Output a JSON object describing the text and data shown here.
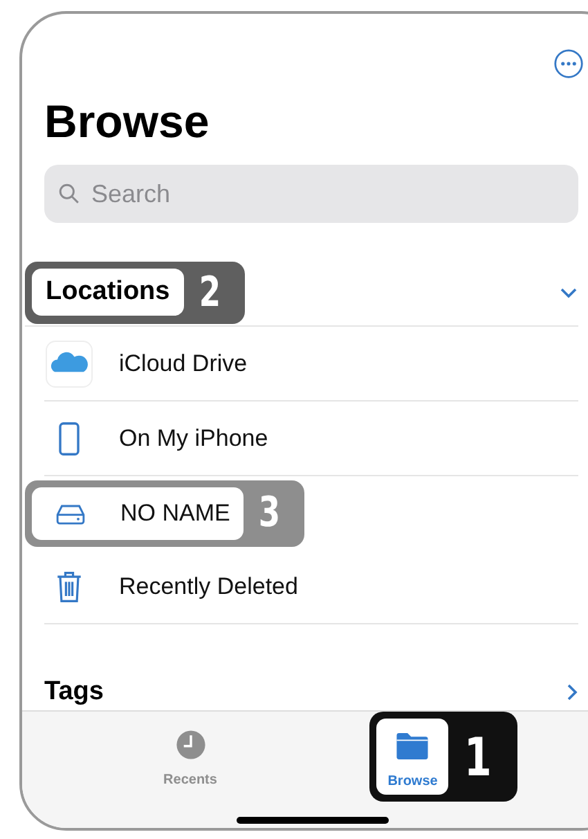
{
  "title": "Browse",
  "search": {
    "placeholder": "Search"
  },
  "locations": {
    "heading": "Locations",
    "expanded": true,
    "callout": {
      "number": "2",
      "color": "#5f5f5f"
    },
    "items": [
      {
        "kind": "cloud",
        "label": "iCloud Drive"
      },
      {
        "kind": "phone",
        "label": "On My iPhone"
      },
      {
        "kind": "drive",
        "label": "NO NAME",
        "callout": {
          "number": "3",
          "color": "#8e8e8e"
        }
      },
      {
        "kind": "trash",
        "label": "Recently Deleted"
      }
    ]
  },
  "tags": {
    "heading": "Tags"
  },
  "tabs": [
    {
      "kind": "clock",
      "label": "Recents",
      "selected": false
    },
    {
      "kind": "folder",
      "label": "Browse",
      "selected": true,
      "callout": {
        "number": "1",
        "color": "#111111"
      }
    }
  ]
}
